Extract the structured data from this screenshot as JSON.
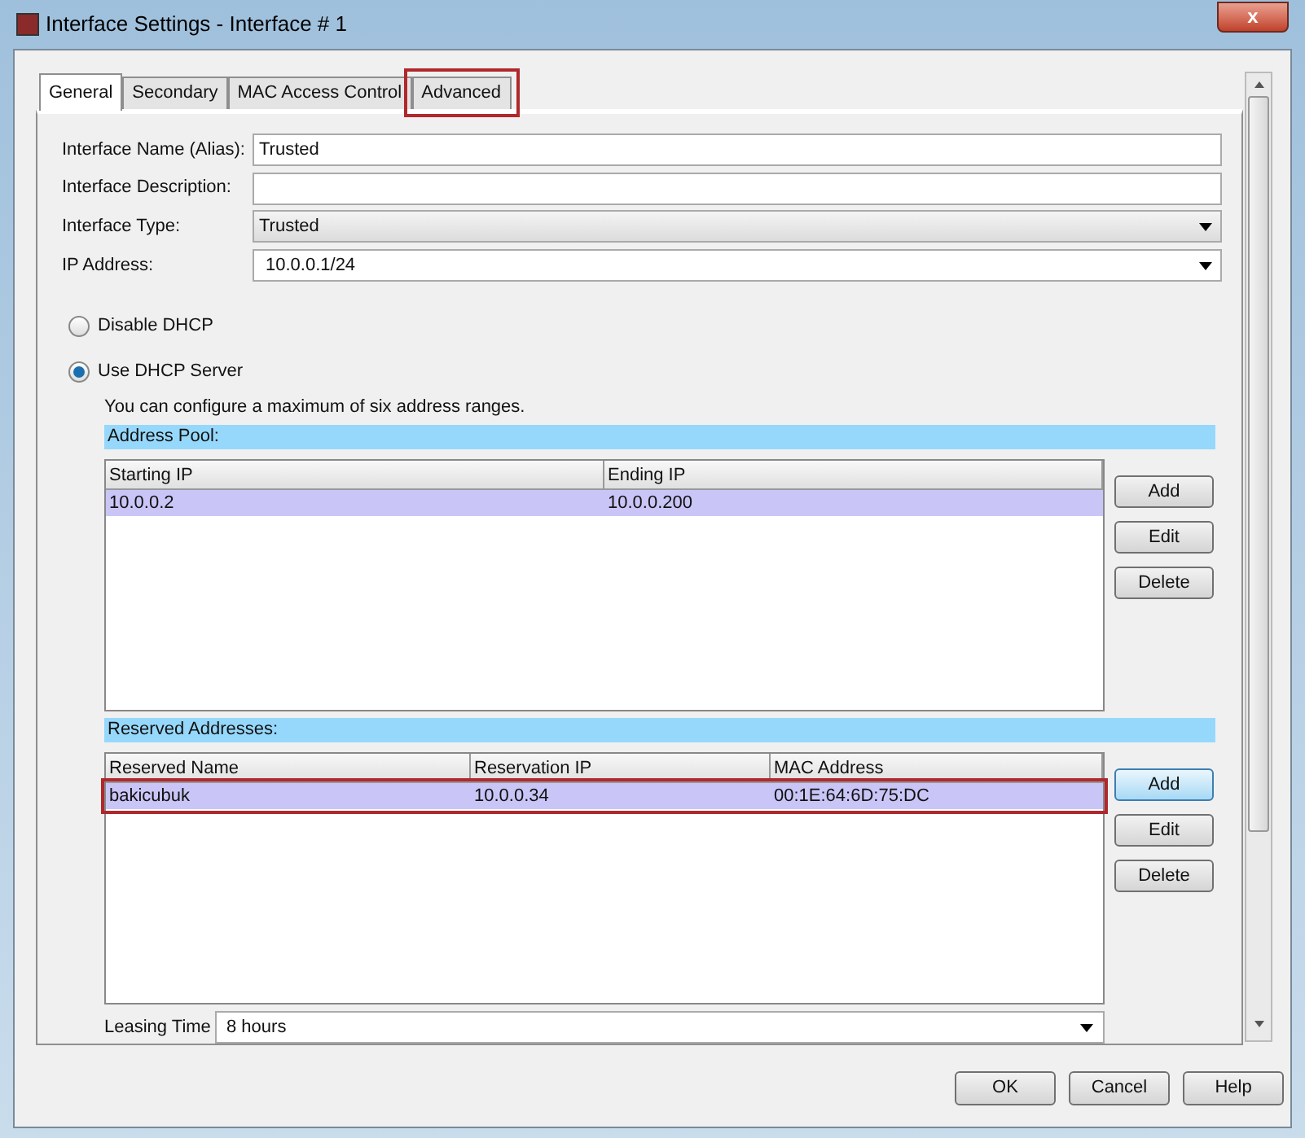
{
  "window": {
    "title": "Interface Settings - Interface # 1",
    "close": "x"
  },
  "tabs": [
    {
      "label": "General",
      "selected": true,
      "highlighted": false
    },
    {
      "label": "Secondary",
      "selected": false,
      "highlighted": false
    },
    {
      "label": "MAC Access Control",
      "selected": false,
      "highlighted": false
    },
    {
      "label": "Advanced",
      "selected": false,
      "highlighted": true
    }
  ],
  "fields": [
    {
      "kind": "text",
      "label": "Interface Name (Alias):",
      "value": "Trusted"
    },
    {
      "kind": "text",
      "label": "Interface Description:"
    },
    {
      "kind": "select",
      "label": "Interface Type:",
      "value": "Trusted"
    },
    {
      "kind": "combo",
      "label": "IP Address:",
      "value": "10.0.0.1/24"
    }
  ],
  "dhcp_options": [
    {
      "label": "Disable DHCP",
      "selected": false
    },
    {
      "label": "Use DHCP Server",
      "selected": true
    }
  ],
  "note": "You can configure a maximum of six address ranges.",
  "address_pool": {
    "title": "Address Pool:",
    "columns": [
      "Starting IP",
      "Ending IP"
    ],
    "rows": [
      {
        "cells": [
          "10.0.0.2",
          "10.0.0.200"
        ],
        "selected": true,
        "highlighted": false
      }
    ],
    "buttons": [
      {
        "label": "Add",
        "focused": false
      },
      {
        "label": "Edit",
        "focused": false
      },
      {
        "label": "Delete",
        "focused": false
      }
    ]
  },
  "reserved_addresses": {
    "title": "Reserved Addresses:",
    "columns": [
      "Reserved Name",
      "Reservation IP",
      "MAC Address"
    ],
    "rows": [
      {
        "cells": [
          "bakicubuk",
          "10.0.0.34",
          "00:1E:64:6D:75:DC"
        ],
        "selected": true,
        "highlighted": true
      }
    ],
    "buttons": [
      {
        "label": "Add",
        "focused": true
      },
      {
        "label": "Edit",
        "focused": false
      },
      {
        "label": "Delete",
        "focused": false
      }
    ]
  },
  "leasing_time": {
    "label": "Leasing Time",
    "value": "8 hours"
  },
  "buttons": [
    "OK",
    "Cancel",
    "Help"
  ]
}
